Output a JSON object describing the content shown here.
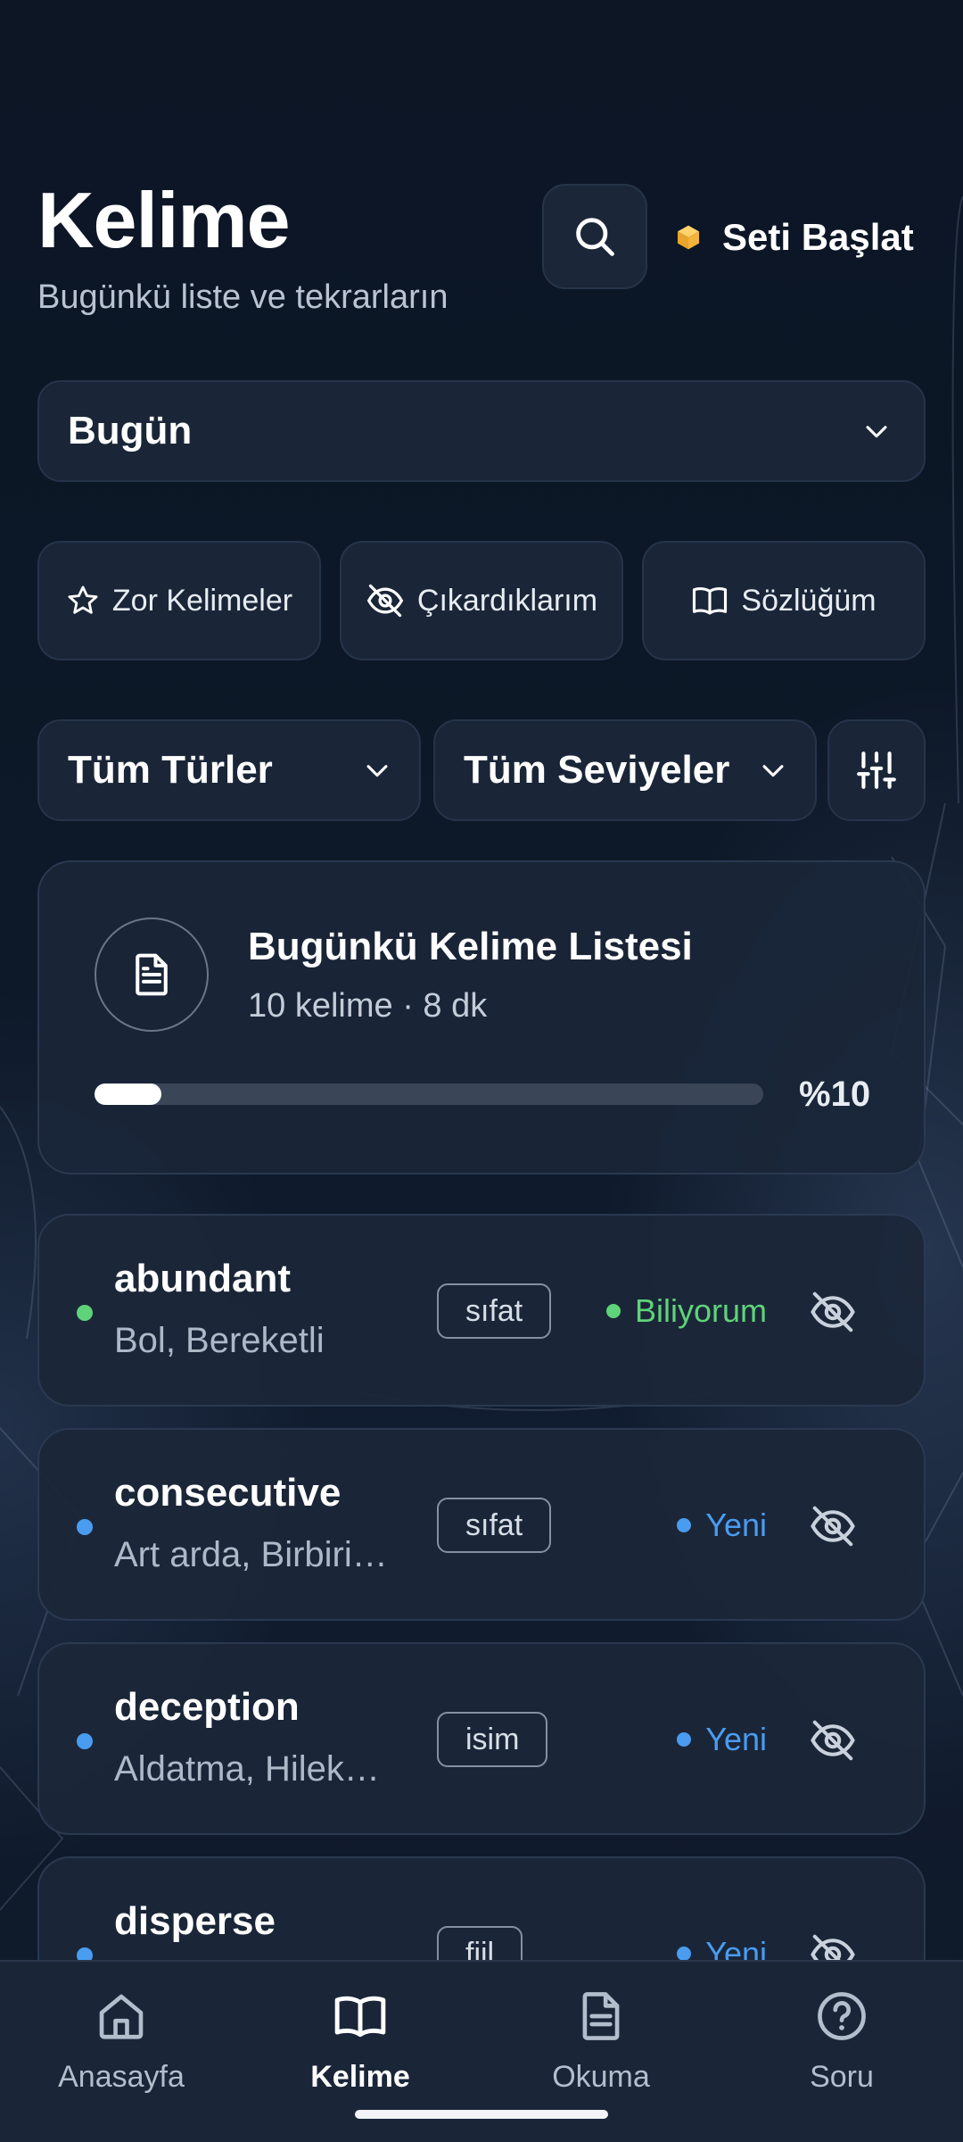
{
  "header": {
    "title": "Kelime",
    "subtitle": "Bugünkü liste ve tekrarların",
    "start_set_label": "Seti Başlat"
  },
  "period_select": {
    "value": "Bugün"
  },
  "quick_actions": [
    {
      "label": "Zor Kelimeler",
      "icon": "star-icon"
    },
    {
      "label": "Çıkardıklarım",
      "icon": "eye-off-icon"
    },
    {
      "label": "Sözlüğüm",
      "icon": "book-icon"
    }
  ],
  "filters": {
    "type": "Tüm Türler",
    "level": "Tüm Seviyeler"
  },
  "daily_list": {
    "title": "Bugünkü Kelime Listesi",
    "meta": "10 kelime · 8 dk",
    "progress": 0.1,
    "progress_label": "%10"
  },
  "words": [
    {
      "word": "abundant",
      "meaning": "Bol, Bereketli",
      "type": "sıfat",
      "status": "Biliyorum",
      "status_color": "#5fd37a"
    },
    {
      "word": "consecutive",
      "meaning": "Art arda, Birbiri…",
      "type": "sıfat",
      "status": "Yeni",
      "status_color": "#4a9cf0"
    },
    {
      "word": "deception",
      "meaning": "Aldatma, Hilek…",
      "type": "isim",
      "status": "Yeni",
      "status_color": "#4a9cf0"
    },
    {
      "word": "disperse",
      "meaning": "",
      "type": "fiil",
      "status": "Yeni",
      "status_color": "#4a9cf0"
    }
  ],
  "nav": [
    {
      "label": "Anasayfa",
      "icon": "home-icon"
    },
    {
      "label": "Kelime",
      "icon": "book-icon"
    },
    {
      "label": "Okuma",
      "icon": "document-icon"
    },
    {
      "label": "Soru",
      "icon": "question-icon"
    }
  ],
  "colors": {
    "background": "#0c1625",
    "card": "#1a2638",
    "known": "#5fd37a",
    "new": "#4a9cf0",
    "accent_cube": "#f2b43a"
  }
}
